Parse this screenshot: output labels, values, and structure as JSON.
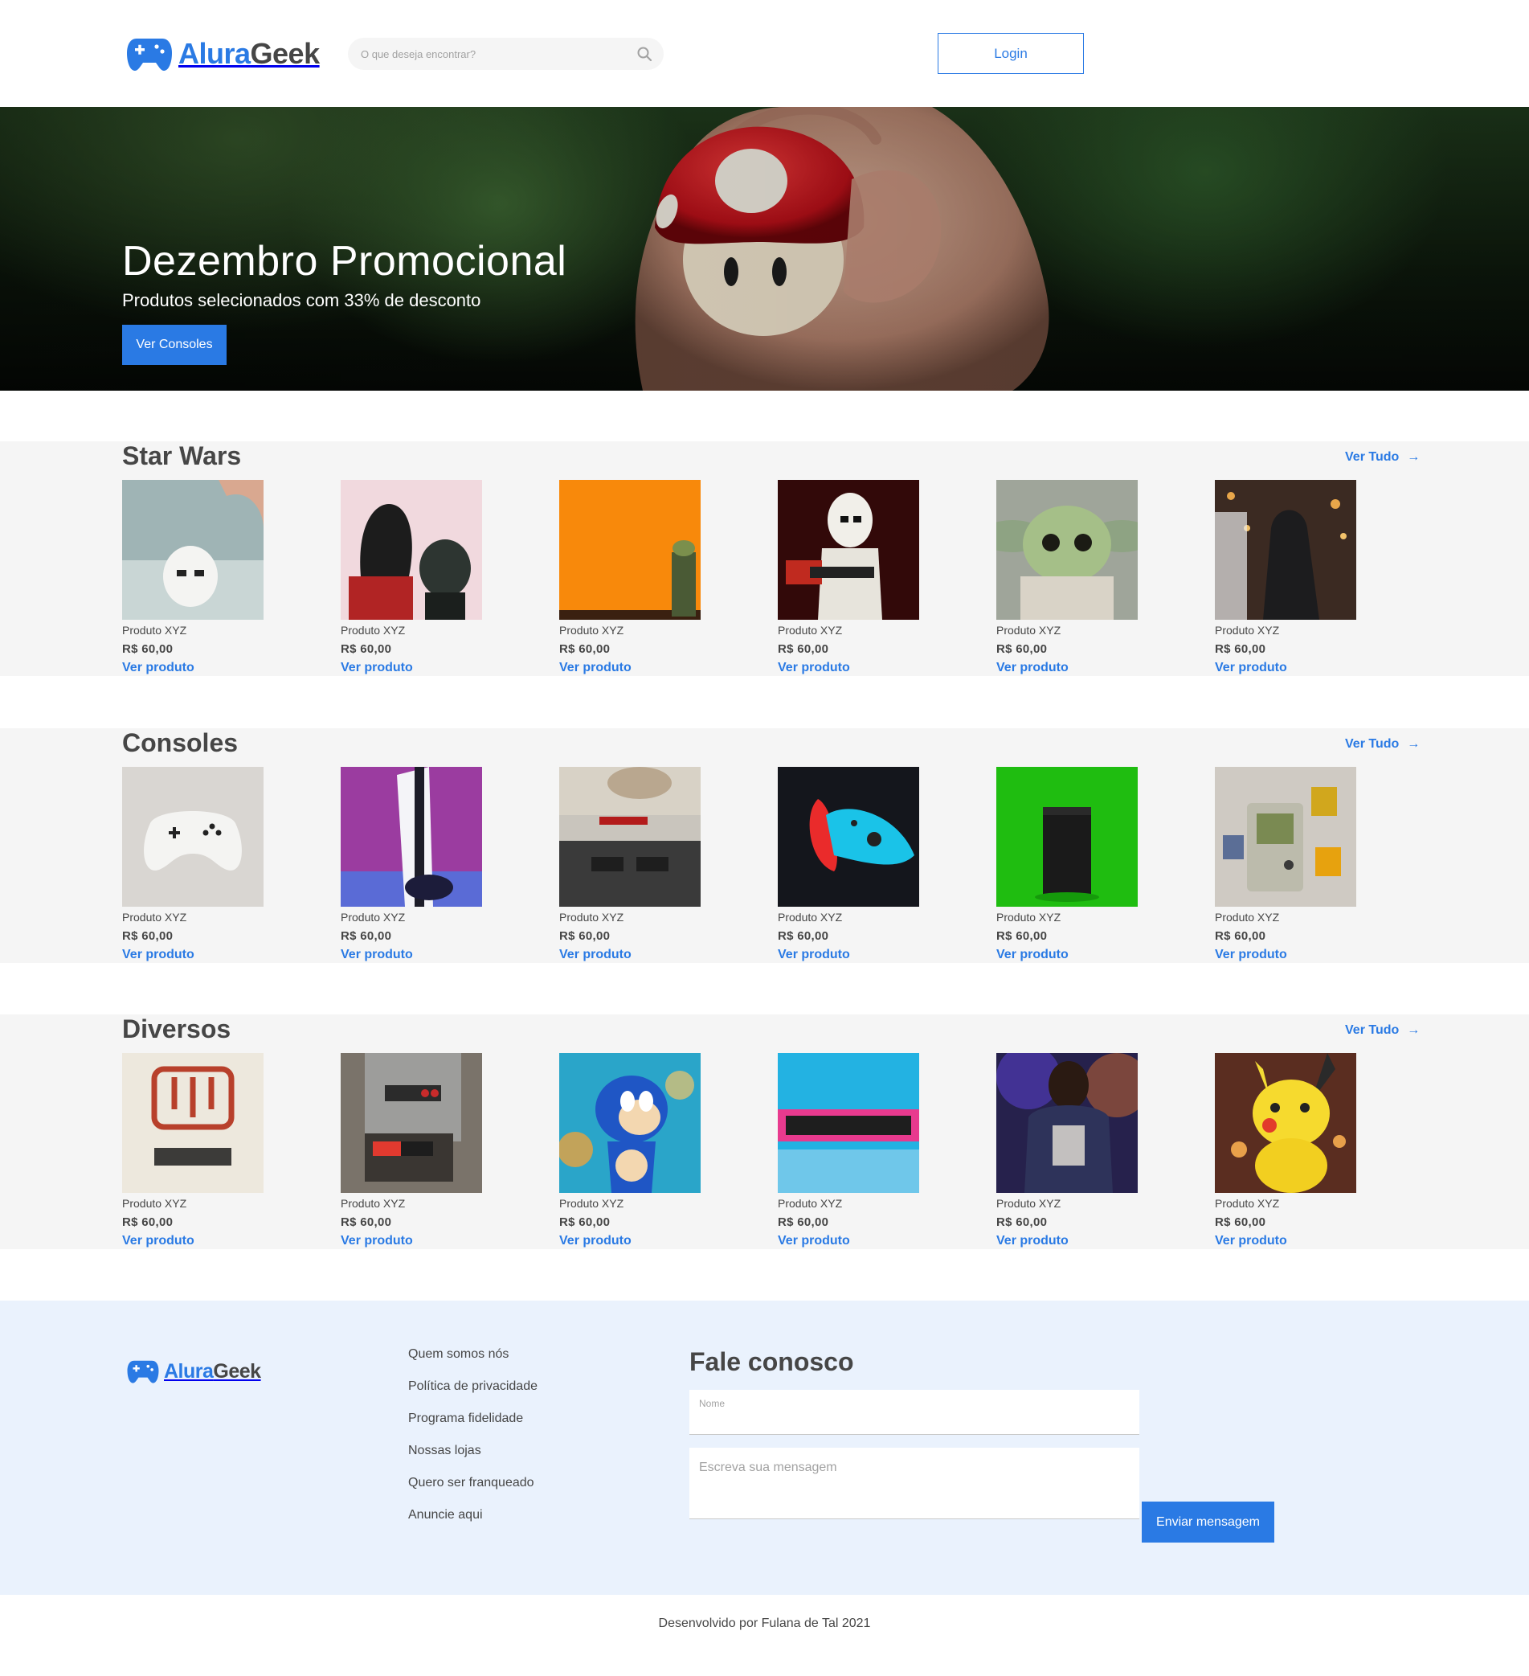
{
  "header": {
    "logo_part1": "Alura",
    "logo_part2": "Geek",
    "search_placeholder": "O que deseja encontrar?",
    "login_label": "Login"
  },
  "banner": {
    "title": "Dezembro Promocional",
    "subtitle": "Produtos selecionados com 33% de desconto",
    "button_label": "Ver Consoles"
  },
  "sections": [
    {
      "title": "Star Wars",
      "ver_tudo": "Ver Tudo",
      "products": [
        {
          "name": "Produto XYZ",
          "price": "R$ 60,00",
          "link": "Ver produto"
        },
        {
          "name": "Produto XYZ",
          "price": "R$ 60,00",
          "link": "Ver produto"
        },
        {
          "name": "Produto XYZ",
          "price": "R$ 60,00",
          "link": "Ver produto"
        },
        {
          "name": "Produto XYZ",
          "price": "R$ 60,00",
          "link": "Ver produto"
        },
        {
          "name": "Produto XYZ",
          "price": "R$ 60,00",
          "link": "Ver produto"
        },
        {
          "name": "Produto XYZ",
          "price": "R$ 60,00",
          "link": "Ver produto"
        }
      ]
    },
    {
      "title": "Consoles",
      "ver_tudo": "Ver Tudo",
      "products": [
        {
          "name": "Produto XYZ",
          "price": "R$ 60,00",
          "link": "Ver produto"
        },
        {
          "name": "Produto XYZ",
          "price": "R$ 60,00",
          "link": "Ver produto"
        },
        {
          "name": "Produto XYZ",
          "price": "R$ 60,00",
          "link": "Ver produto"
        },
        {
          "name": "Produto XYZ",
          "price": "R$ 60,00",
          "link": "Ver produto"
        },
        {
          "name": "Produto XYZ",
          "price": "R$ 60,00",
          "link": "Ver produto"
        },
        {
          "name": "Produto XYZ",
          "price": "R$ 60,00",
          "link": "Ver produto"
        }
      ]
    },
    {
      "title": "Diversos",
      "ver_tudo": "Ver Tudo",
      "products": [
        {
          "name": "Produto XYZ",
          "price": "R$ 60,00",
          "link": "Ver produto"
        },
        {
          "name": "Produto XYZ",
          "price": "R$ 60,00",
          "link": "Ver produto"
        },
        {
          "name": "Produto XYZ",
          "price": "R$ 60,00",
          "link": "Ver produto"
        },
        {
          "name": "Produto XYZ",
          "price": "R$ 60,00",
          "link": "Ver produto"
        },
        {
          "name": "Produto XYZ",
          "price": "R$ 60,00",
          "link": "Ver produto"
        },
        {
          "name": "Produto XYZ",
          "price": "R$ 60,00",
          "link": "Ver produto"
        }
      ]
    }
  ],
  "footer": {
    "logo_part1": "Alura",
    "logo_part2": "Geek",
    "links": [
      "Quem somos nós",
      "Política de privacidade",
      "Programa fidelidade",
      "Nossas lojas",
      "Quero ser franqueado",
      "Anuncie aqui"
    ],
    "contact_title": "Fale conosco",
    "name_label": "Nome",
    "message_placeholder": "Escreva sua mensagem",
    "send_label": "Enviar mensagem"
  },
  "credits": "Desenvolvido por Fulana de Tal 2021",
  "colors": {
    "accent": "#2a7ae4",
    "text": "#464646",
    "section_bg": "#f5f5f5",
    "footer_bg": "#eaf2fd"
  }
}
